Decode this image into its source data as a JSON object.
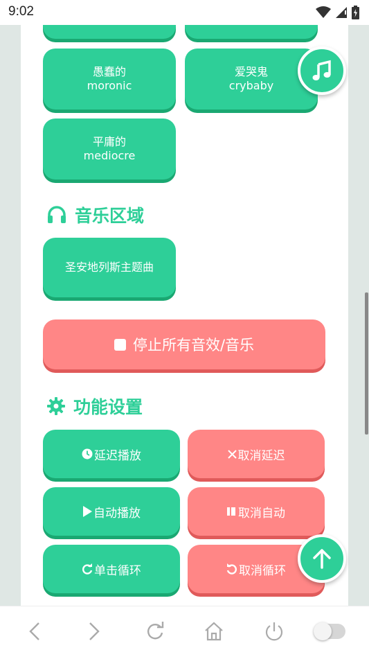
{
  "status": {
    "time": "9:02"
  },
  "mood_buttons": [
    {
      "cn": "愚蠢的",
      "en": "moronic"
    },
    {
      "cn": "爱哭鬼",
      "en": "crybaby"
    },
    {
      "cn": "平庸的",
      "en": "mediocre"
    }
  ],
  "music_section": {
    "title": "音乐区域",
    "track": "圣安地列斯主题曲",
    "stop_all": "停止所有音效/音乐"
  },
  "settings_section": {
    "title": "功能设置",
    "delay_play": "延迟播放",
    "cancel_delay": "取消延迟",
    "auto_play": "自动播放",
    "cancel_auto": "取消自动",
    "loop_single": "单击循环",
    "cancel_loop": "取消循环"
  },
  "colors": {
    "accent_green": "#2ecf98",
    "accent_red": "#ff8686"
  },
  "icons": [
    "music-note-icon",
    "headphones-icon",
    "gear-icon",
    "arrow-up-icon"
  ]
}
